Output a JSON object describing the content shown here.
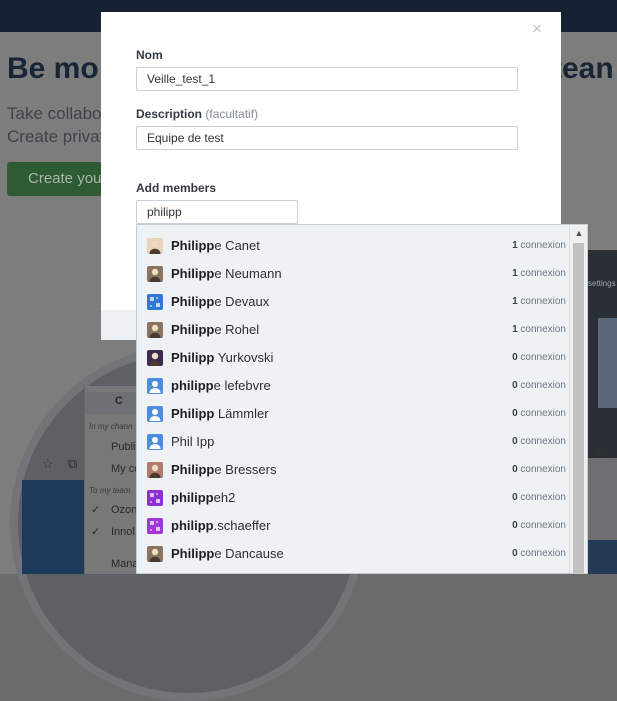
{
  "background": {
    "heading_left": "Be mo",
    "heading_right": "tean",
    "sub_line1": "Take collabo",
    "sub_line2": "Create private",
    "green_button": "Create you",
    "panel": {
      "tab_label": "C",
      "section_channels": "In my chann",
      "item_public": "Publi",
      "item_my": "My co",
      "section_teams": "To my team",
      "item_ozone": "Ozon",
      "item_innol": "Innol",
      "item_manage": "Mana"
    },
    "settings_text": "settings",
    "right_text": "h l"
  },
  "modal": {
    "close_label": "×",
    "name_label": "Nom",
    "name_value": "Veille_test_1",
    "description_label": "Description",
    "description_optional": "(facultatif)",
    "description_value": "Equipe de test",
    "members_label": "Add members",
    "members_value": "philipp"
  },
  "dropdown": {
    "scroll_up_label": "▲",
    "items": [
      {
        "match": "Philipp",
        "rest": "e Canet",
        "count": "1",
        "unit": "connexion",
        "avatar": "face"
      },
      {
        "match": "Philipp",
        "rest": "e Neumann",
        "count": "1",
        "unit": "connexion",
        "avatar": "photo"
      },
      {
        "match": "Philipp",
        "rest": "e Devaux",
        "count": "1",
        "unit": "connexion",
        "avatar": "pattern-blue"
      },
      {
        "match": "Philipp",
        "rest": "e Rohel",
        "count": "1",
        "unit": "connexion",
        "avatar": "photo"
      },
      {
        "match": "Philipp",
        "rest": " Yurkovski",
        "count": "0",
        "unit": "connexion",
        "avatar": "dark"
      },
      {
        "match": "philipp",
        "rest": "e lefebvre",
        "count": "0",
        "unit": "connexion",
        "avatar": "generic"
      },
      {
        "match": "Philipp",
        "rest": " Lämmler",
        "count": "0",
        "unit": "connexion",
        "avatar": "generic"
      },
      {
        "match": "",
        "rest": "Phil Ipp",
        "count": "0",
        "unit": "connexion",
        "avatar": "generic"
      },
      {
        "match": "Philipp",
        "rest": "e Bressers",
        "count": "0",
        "unit": "connexion",
        "avatar": "pink"
      },
      {
        "match": "philipp",
        "rest": "eh2",
        "count": "0",
        "unit": "connexion",
        "avatar": "pattern-purple"
      },
      {
        "match": "philipp",
        "rest": ".schaeffer",
        "count": "0",
        "unit": "connexion",
        "avatar": "pattern-violet"
      },
      {
        "match": "Philipp",
        "rest": "e Dancause",
        "count": "0",
        "unit": "connexion",
        "avatar": "photo"
      }
    ]
  }
}
